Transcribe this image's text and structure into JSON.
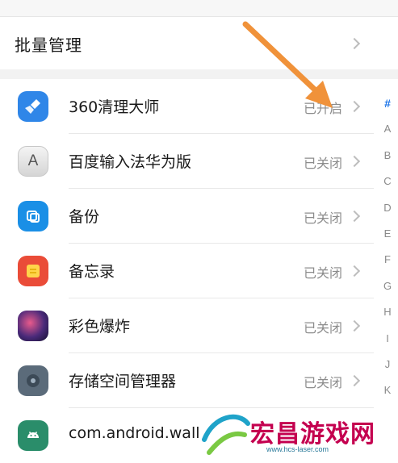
{
  "batch_manage": {
    "label": "批量管理"
  },
  "apps": [
    {
      "name": "360清理大师",
      "status": "已开启",
      "icon": "broom-icon"
    },
    {
      "name": "百度输入法华为版",
      "status": "已关闭",
      "icon": "keyboard-a-icon",
      "icon_glyph": "A"
    },
    {
      "name": "备份",
      "status": "已关闭",
      "icon": "backup-icon"
    },
    {
      "name": "备忘录",
      "status": "已关闭",
      "icon": "memo-icon"
    },
    {
      "name": "彩色爆炸",
      "status": "已关闭",
      "icon": "game-icon"
    },
    {
      "name": "存储空间管理器",
      "status": "已关闭",
      "icon": "storage-icon"
    },
    {
      "name": "com.android.wall",
      "status": "",
      "icon": "android-icon"
    }
  ],
  "index_bar": [
    "#",
    "A",
    "B",
    "C",
    "D",
    "E",
    "F",
    "G",
    "H",
    "I",
    "J",
    "K"
  ],
  "index_active": "#",
  "watermark": {
    "text": "宏昌游戏网",
    "url": "www.hcs-laser.com"
  },
  "colors": {
    "accent": "#1a73e8",
    "arrow": "#f0923a",
    "watermark": "#c4004f"
  }
}
